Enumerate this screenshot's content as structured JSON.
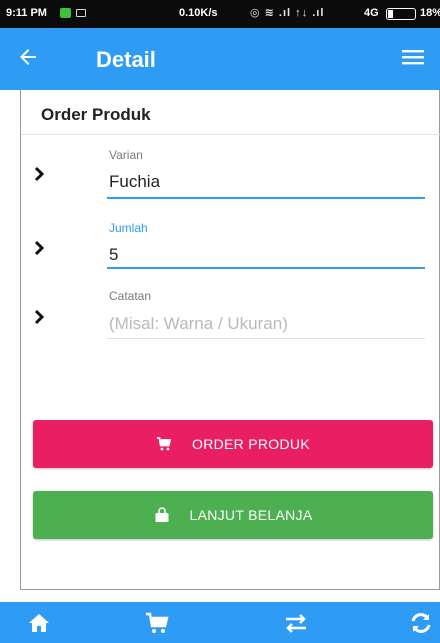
{
  "status_bar": {
    "time": "9:11 PM",
    "speed": "0.10K/s",
    "network": "4G",
    "battery": "18%"
  },
  "app_bar": {
    "title": "Detail",
    "icons": [
      "back-arrow-icon",
      "hamburger-menu-icon"
    ]
  },
  "order_form": {
    "section_title": "Order Produk",
    "fields": [
      {
        "label": "Varian",
        "value": "Fuchia",
        "icon": "chevron-right-icon"
      },
      {
        "label": "Jumlah",
        "value": "5",
        "icon": "chevron-right-icon",
        "focused": true
      },
      {
        "label": "Catatan",
        "placeholder": "(Misal: Warna / Ukuran)",
        "value": "",
        "icon": "chevron-right-icon"
      }
    ]
  },
  "buttons": {
    "order": {
      "label": "ORDER PRODUK",
      "icon": "cart-icon",
      "color": "#e91e63"
    },
    "lanjut": {
      "label": "LANJUT BELANJA",
      "icon": "shopping-bag-icon",
      "color": "#4caf50"
    }
  },
  "bottom_nav": {
    "items": [
      "home-icon",
      "cart-icon",
      "transfer-icon",
      "refresh-icon"
    ]
  },
  "colors": {
    "primary": "#2e9bf5",
    "accent": "#e91e63",
    "success": "#4caf50"
  }
}
